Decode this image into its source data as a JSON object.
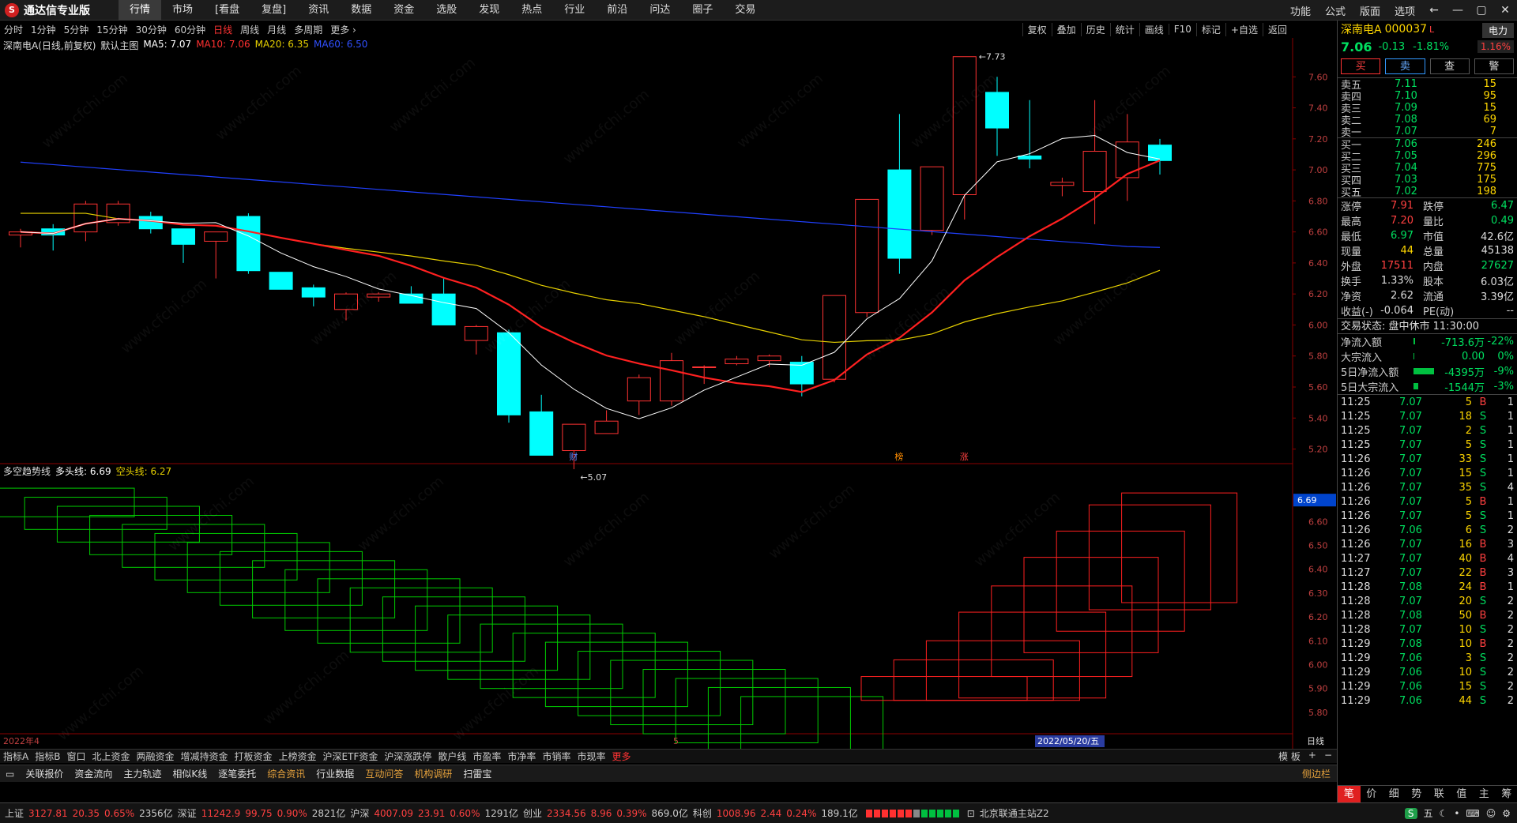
{
  "app": {
    "logo_mark": "S",
    "title": "通达信专业版"
  },
  "menu": [
    "行情",
    "市场",
    "[看盘",
    "复盘]",
    "资讯",
    "数据",
    "资金",
    "选股",
    "发现",
    "热点",
    "行业",
    "前沿",
    "问达",
    "圈子",
    "交易"
  ],
  "menu_active": 0,
  "top_right": [
    "功能",
    "公式",
    "版面",
    "选项"
  ],
  "window_buttons": [
    "←",
    "—",
    "▢",
    "✕"
  ],
  "periods": [
    "分时",
    "1分钟",
    "5分钟",
    "15分钟",
    "30分钟",
    "60分钟",
    "日线",
    "周线",
    "月线",
    "多周期",
    "更多 ›"
  ],
  "period_active": 6,
  "tools": [
    "复权",
    "叠加",
    "历史",
    "统计",
    "画线",
    "F10",
    "标记",
    "+自选",
    "返回"
  ],
  "chart_info": {
    "name": "深南电A(日线,前复权)",
    "template": "默认主图",
    "ma5": "MA5: 7.07",
    "ma10": "MA10: 7.06",
    "ma20": "MA20: 6.35",
    "ma60": "MA60: 6.50"
  },
  "sub_info": {
    "name": "多空趋势线",
    "bull": "多头线: 6.69",
    "bear": "空头线: 6.27"
  },
  "colors": {
    "up": "#ff3333",
    "down": "#00ffff",
    "ma5": "#ffffff",
    "ma10": "#ff2020",
    "ma20": "#e6d000",
    "ma60": "#2040ff",
    "bull_box": "#00cc00",
    "bear_box": "#ff2020"
  },
  "chart_data": {
    "type": "candlestick",
    "y_range": [
      5.05,
      7.8
    ],
    "y_ticks": [
      "7.60",
      "7.40",
      "7.20",
      "7.00",
      "6.80",
      "6.60",
      "6.40",
      "6.20",
      "6.00",
      "5.80",
      "5.60",
      "5.40",
      "5.20"
    ],
    "candles": [
      {
        "o": 6.58,
        "h": 6.62,
        "l": 6.5,
        "c": 6.6
      },
      {
        "o": 6.62,
        "h": 6.65,
        "l": 6.48,
        "c": 6.58
      },
      {
        "o": 6.6,
        "h": 6.8,
        "l": 6.54,
        "c": 6.78
      },
      {
        "o": 6.66,
        "h": 6.8,
        "l": 6.64,
        "c": 6.78
      },
      {
        "o": 6.7,
        "h": 6.73,
        "l": 6.59,
        "c": 6.62
      },
      {
        "o": 6.62,
        "h": 6.62,
        "l": 6.4,
        "c": 6.52
      },
      {
        "o": 6.54,
        "h": 6.59,
        "l": 6.3,
        "c": 6.6
      },
      {
        "o": 6.7,
        "h": 6.72,
        "l": 6.33,
        "c": 6.35
      },
      {
        "o": 6.34,
        "h": 6.34,
        "l": 6.23,
        "c": 6.23
      },
      {
        "o": 6.24,
        "h": 6.26,
        "l": 6.12,
        "c": 6.18
      },
      {
        "o": 6.1,
        "h": 6.21,
        "l": 6.03,
        "c": 6.2
      },
      {
        "o": 6.18,
        "h": 6.21,
        "l": 6.15,
        "c": 6.2
      },
      {
        "o": 6.2,
        "h": 6.25,
        "l": 6.14,
        "c": 6.14
      },
      {
        "o": 6.2,
        "h": 6.3,
        "l": 6.02,
        "c": 6.0
      },
      {
        "o": 5.9,
        "h": 6.0,
        "l": 5.81,
        "c": 5.99
      },
      {
        "o": 5.95,
        "h": 5.97,
        "l": 5.37,
        "c": 5.42
      },
      {
        "o": 5.44,
        "h": 5.55,
        "l": 5.16,
        "c": 5.16
      },
      {
        "o": 5.19,
        "h": 5.36,
        "l": 5.07,
        "c": 5.36
      },
      {
        "o": 5.3,
        "h": 5.45,
        "l": 5.3,
        "c": 5.38
      },
      {
        "o": 5.51,
        "h": 5.68,
        "l": 5.42,
        "c": 5.66
      },
      {
        "o": 5.51,
        "h": 5.82,
        "l": 5.48,
        "c": 5.77
      },
      {
        "o": 5.73,
        "h": 5.74,
        "l": 5.62,
        "c": 5.73
      },
      {
        "o": 5.75,
        "h": 5.8,
        "l": 5.74,
        "c": 5.78
      },
      {
        "o": 5.77,
        "h": 5.81,
        "l": 5.73,
        "c": 5.8
      },
      {
        "o": 5.76,
        "h": 5.8,
        "l": 5.54,
        "c": 5.62
      },
      {
        "o": 5.65,
        "h": 6.19,
        "l": 5.63,
        "c": 6.19
      },
      {
        "o": 6.08,
        "h": 6.81,
        "l": 6.05,
        "c": 6.81
      },
      {
        "o": 7.0,
        "h": 7.36,
        "l": 6.33,
        "c": 6.43
      },
      {
        "o": 6.61,
        "h": 7.02,
        "l": 6.58,
        "c": 7.02
      },
      {
        "o": 6.84,
        "h": 7.73,
        "l": 6.68,
        "c": 7.73
      },
      {
        "o": 7.5,
        "h": 7.6,
        "l": 7.09,
        "c": 7.27
      },
      {
        "o": 7.09,
        "h": 7.45,
        "l": 7.01,
        "c": 7.07
      },
      {
        "o": 6.9,
        "h": 6.95,
        "l": 6.83,
        "c": 6.92
      },
      {
        "o": 6.86,
        "h": 7.45,
        "l": 6.65,
        "c": 7.12
      },
      {
        "o": 6.95,
        "h": 7.36,
        "l": 6.8,
        "c": 7.18
      },
      {
        "o": 7.16,
        "h": 7.2,
        "l": 6.97,
        "c": 7.06
      }
    ],
    "annotations": {
      "high": "7.73",
      "low": "5.07",
      "markers": [
        "财",
        "榜",
        "涨"
      ]
    },
    "x_labels": {
      "start": "2022年4",
      "mid": "5",
      "cursor": "2022/05/20/五"
    },
    "sub_y_range": [
      5.72,
      6.78
    ],
    "sub_y_ticks": [
      "6.60",
      "6.50",
      "6.40",
      "6.30",
      "6.20",
      "6.10",
      "6.00",
      "5.90",
      "5.80"
    ],
    "sub_value": "6.69"
  },
  "bottom_ind": [
    "指标A",
    "指标B",
    "窗口",
    "北上资金",
    "两融资金",
    "增减持资金",
    "打板资金",
    "上榜资金",
    "沪深ETF资金",
    "沪深涨跌停",
    "散户线",
    "市盈率",
    "市净率",
    "市销率",
    "市现率",
    "更多"
  ],
  "bottom_ind_right": [
    "模 板",
    "+",
    "−"
  ],
  "funcs": [
    "关联报价",
    "资金流向",
    "主力轨迹",
    "相似K线",
    "逐笔委托",
    "综合资讯",
    "行业数据",
    "互动问答",
    "机构调研",
    "扫雷宝"
  ],
  "funcs_highlight": [
    5,
    7,
    8
  ],
  "side_btn": "侧边栏",
  "date_btn": "日线",
  "status": [
    {
      "n": "上证",
      "v": "3127.81",
      "c": "20.35",
      "p": "0.65%",
      "a": "2356亿"
    },
    {
      "n": "深证",
      "v": "11242.9",
      "c": "99.75",
      "p": "0.90%",
      "a": "2821亿"
    },
    {
      "n": "沪深",
      "v": "4007.09",
      "c": "23.91",
      "p": "0.60%",
      "a": "1291亿"
    },
    {
      "n": "创业",
      "v": "2334.56",
      "c": "8.96",
      "p": "0.39%",
      "a": "869.0亿"
    },
    {
      "n": "科创",
      "v": "1008.96",
      "c": "2.44",
      "p": "0.24%",
      "a": "189.1亿"
    }
  ],
  "server": "北京联通主站Z2",
  "status_right": "五",
  "stock": {
    "name": "深南电A",
    "code": "000037",
    "flag": "L",
    "sector": "电力",
    "price": "7.06",
    "change": "-0.13",
    "pct": "-1.81%",
    "vol_pct": "1.16%"
  },
  "trade_buttons": [
    "买",
    "卖",
    "查",
    "警"
  ],
  "asks": [
    {
      "l": "卖五",
      "p": "7.11",
      "v": "15"
    },
    {
      "l": "卖四",
      "p": "7.10",
      "v": "95"
    },
    {
      "l": "卖三",
      "p": "7.09",
      "v": "15"
    },
    {
      "l": "卖二",
      "p": "7.08",
      "v": "69"
    },
    {
      "l": "卖一",
      "p": "7.07",
      "v": "7"
    }
  ],
  "bids": [
    {
      "l": "买一",
      "p": "7.06",
      "v": "246"
    },
    {
      "l": "买二",
      "p": "7.05",
      "v": "296"
    },
    {
      "l": "买三",
      "p": "7.04",
      "v": "775"
    },
    {
      "l": "买四",
      "p": "7.03",
      "v": "175"
    },
    {
      "l": "买五",
      "p": "7.02",
      "v": "198"
    }
  ],
  "info": [
    {
      "a": "涨停",
      "b": "7.91",
      "bc": "r",
      "c": "跌停",
      "d": "6.47",
      "dc": "g"
    },
    {
      "a": "最高",
      "b": "7.20",
      "bc": "r",
      "c": "量比",
      "d": "0.49",
      "dc": "g"
    },
    {
      "a": "最低",
      "b": "6.97",
      "bc": "g",
      "c": "市值",
      "d": "42.6亿",
      "dc": "wt"
    },
    {
      "a": "现量",
      "b": "44",
      "bc": "y",
      "c": "总量",
      "d": "45138",
      "dc": "wt"
    },
    {
      "a": "外盘",
      "b": "17511",
      "bc": "r",
      "c": "内盘",
      "d": "27627",
      "dc": "g"
    },
    {
      "a": "换手",
      "b": "1.33%",
      "bc": "wt",
      "c": "股本",
      "d": "6.03亿",
      "dc": "wt"
    },
    {
      "a": "净资",
      "b": "2.62",
      "bc": "wt",
      "c": "流通",
      "d": "3.39亿",
      "dc": "wt"
    },
    {
      "a": "收益(-)",
      "b": "-0.064",
      "bc": "wt",
      "c": "PE(动)",
      "d": "--",
      "dc": "wt"
    }
  ],
  "trade_state": "交易状态: 盘中休市 11:30:00",
  "flows": [
    {
      "l": "净流入额",
      "bar": 2,
      "v1": "-713.6万",
      "v2": "-22%"
    },
    {
      "l": "大宗流入",
      "bar": 1,
      "v1": "0.00",
      "v2": "0%"
    },
    {
      "l": "5日净流入额",
      "bar": 26,
      "v1": "-4395万",
      "v2": "-9%"
    },
    {
      "l": "5日大宗流入",
      "bar": 6,
      "v1": "-1544万",
      "v2": "-3%"
    }
  ],
  "ticks": [
    {
      "t": "11:25",
      "p": "7.07",
      "v": "5",
      "d": "B",
      "n": "1"
    },
    {
      "t": "11:25",
      "p": "7.07",
      "v": "18",
      "d": "S",
      "n": "1"
    },
    {
      "t": "11:25",
      "p": "7.07",
      "v": "2",
      "d": "S",
      "n": "1"
    },
    {
      "t": "11:25",
      "p": "7.07",
      "v": "5",
      "d": "S",
      "n": "1"
    },
    {
      "t": "11:26",
      "p": "7.07",
      "v": "33",
      "d": "S",
      "n": "1"
    },
    {
      "t": "11:26",
      "p": "7.07",
      "v": "15",
      "d": "S",
      "n": "1"
    },
    {
      "t": "11:26",
      "p": "7.07",
      "v": "35",
      "d": "S",
      "n": "4"
    },
    {
      "t": "11:26",
      "p": "7.07",
      "v": "5",
      "d": "B",
      "n": "1"
    },
    {
      "t": "11:26",
      "p": "7.07",
      "v": "5",
      "d": "S",
      "n": "1"
    },
    {
      "t": "11:26",
      "p": "7.06",
      "v": "6",
      "d": "S",
      "n": "2"
    },
    {
      "t": "11:26",
      "p": "7.07",
      "v": "16",
      "d": "B",
      "n": "3"
    },
    {
      "t": "11:27",
      "p": "7.07",
      "v": "40",
      "d": "B",
      "n": "4"
    },
    {
      "t": "11:27",
      "p": "7.07",
      "v": "22",
      "d": "B",
      "n": "3"
    },
    {
      "t": "11:28",
      "p": "7.08",
      "v": "24",
      "d": "B",
      "n": "1"
    },
    {
      "t": "11:28",
      "p": "7.07",
      "v": "20",
      "d": "S",
      "n": "2"
    },
    {
      "t": "11:28",
      "p": "7.08",
      "v": "50",
      "d": "B",
      "n": "2"
    },
    {
      "t": "11:28",
      "p": "7.07",
      "v": "10",
      "d": "S",
      "n": "2"
    },
    {
      "t": "11:29",
      "p": "7.08",
      "v": "10",
      "d": "B",
      "n": "2"
    },
    {
      "t": "11:29",
      "p": "7.06",
      "v": "3",
      "d": "S",
      "n": "2"
    },
    {
      "t": "11:29",
      "p": "7.06",
      "v": "10",
      "d": "S",
      "n": "2"
    },
    {
      "t": "11:29",
      "p": "7.06",
      "v": "15",
      "d": "S",
      "n": "2"
    },
    {
      "t": "11:29",
      "p": "7.06",
      "v": "44",
      "d": "S",
      "n": "2"
    }
  ],
  "right_tabs": [
    "笔",
    "价",
    "细",
    "势",
    "联",
    "值",
    "主",
    "筹"
  ],
  "right_tab_active": 0
}
